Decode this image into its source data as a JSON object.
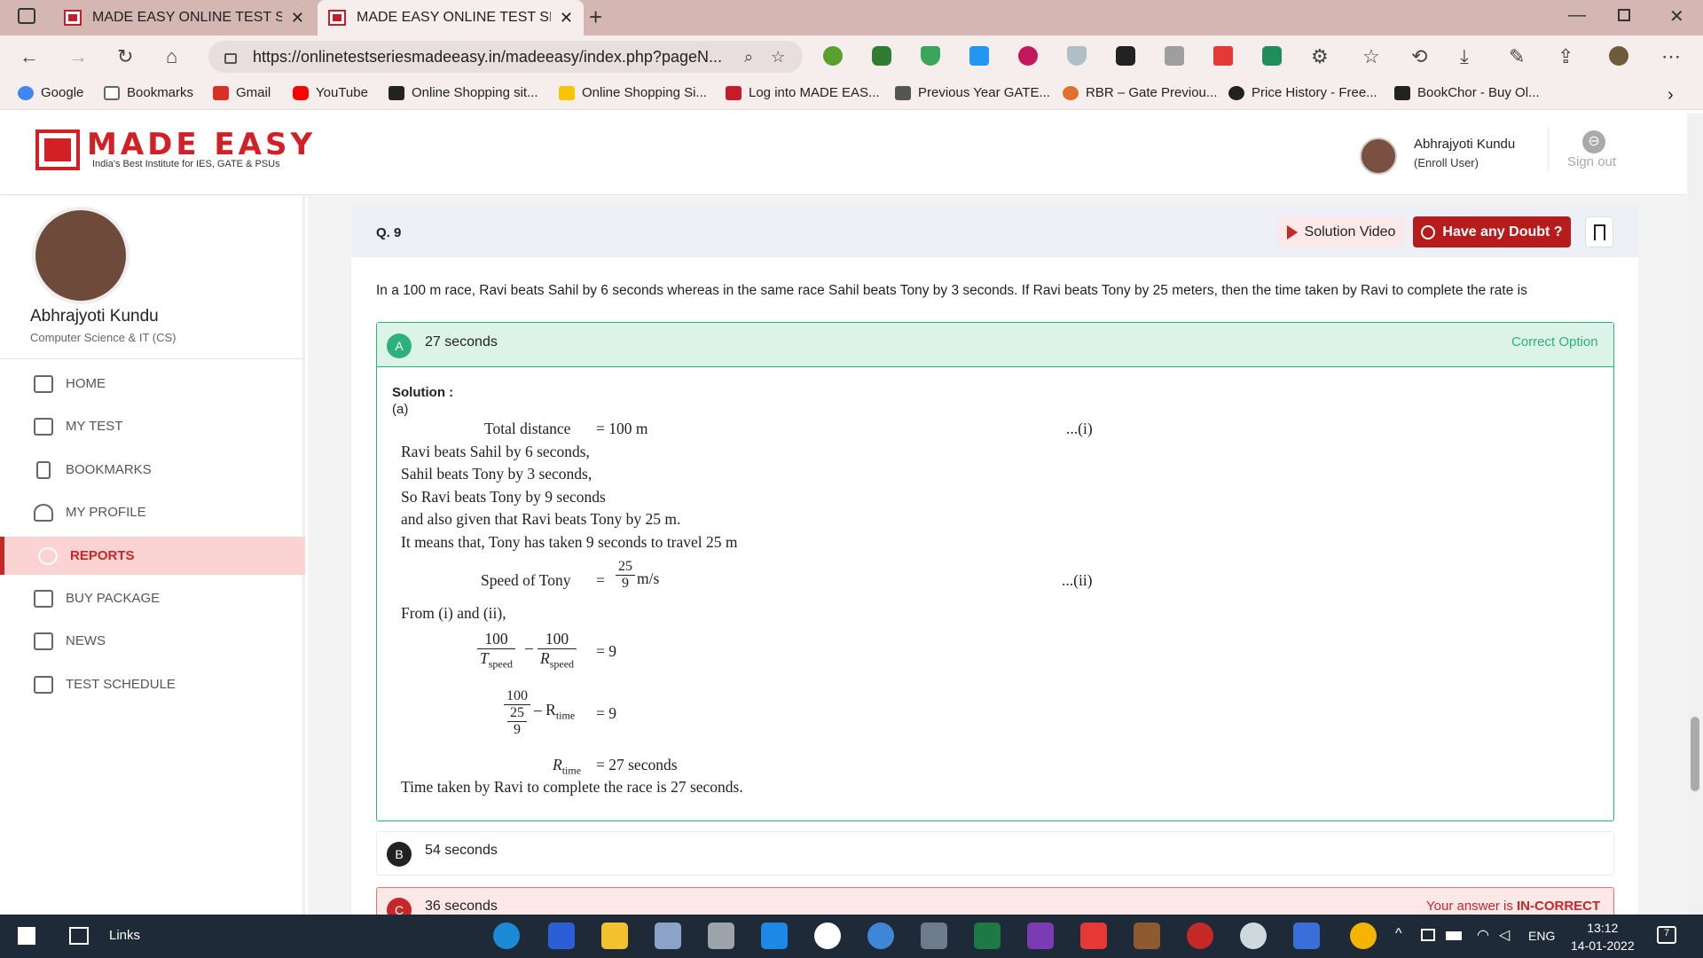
{
  "browser": {
    "tabs": [
      {
        "title": "MADE EASY ONLINE TEST SERIES"
      },
      {
        "title": "MADE EASY ONLINE TEST SERIES"
      }
    ],
    "new_tab": "+",
    "url": "https://onlinetestseriesmadeeasy.in/madeeasy/index.php?pageN...",
    "bookmarks": [
      {
        "label": "Google",
        "icon": "google-icon",
        "color": "#4285f4"
      },
      {
        "label": "Bookmarks",
        "icon": "page-icon",
        "color": "#666666"
      },
      {
        "label": "Gmail",
        "icon": "gmail-icon",
        "color": "#d93025"
      },
      {
        "label": "YouTube",
        "icon": "youtube-icon",
        "color": "#ff0000"
      },
      {
        "label": "Online Shopping sit...",
        "icon": "amazon-icon",
        "color": "#222222"
      },
      {
        "label": "Online Shopping Si...",
        "icon": "flipkart-icon",
        "color": "#f7c600"
      },
      {
        "label": "Log into MADE EAS...",
        "icon": "madeeasy-icon",
        "color": "#c41e2a"
      },
      {
        "label": "Previous Year GATE...",
        "icon": "gate-icon",
        "color": "#555555"
      },
      {
        "label": "RBR – Gate Previou...",
        "icon": "rbr-icon",
        "color": "#e0702a"
      },
      {
        "label": "Price History - Free...",
        "icon": "pricehistory-icon",
        "color": "#222222"
      },
      {
        "label": "BookChor - Buy Ol...",
        "icon": "bookchor-icon",
        "color": "#222222"
      }
    ]
  },
  "site": {
    "logo_name": "MADE EASY",
    "logo_tagline": "India's Best Institute for IES, GATE & PSUs",
    "user_name": "Abhrajyoti Kundu",
    "user_role": "(Enroll User)",
    "signout": "Sign out"
  },
  "sidebar": {
    "name": "Abhrajyoti Kundu",
    "branch": "Computer Science & IT (CS)",
    "menu": [
      {
        "label": "HOME",
        "icon": "home-icon"
      },
      {
        "label": "MY TEST",
        "icon": "test-icon"
      },
      {
        "label": "BOOKMARKS",
        "icon": "bookmark-icon"
      },
      {
        "label": "MY PROFILE",
        "icon": "user-icon"
      },
      {
        "label": "REPORTS",
        "icon": "reports-icon",
        "active": true
      },
      {
        "label": "BUY PACKAGE",
        "icon": "cart-icon"
      },
      {
        "label": "NEWS",
        "icon": "news-icon"
      },
      {
        "label": "TEST SCHEDULE",
        "icon": "schedule-icon"
      }
    ]
  },
  "question": {
    "number": "Q. 9",
    "solution_video": "Solution Video",
    "doubt": "Have any Doubt ?",
    "text": "In a 100 m race, Ravi beats Sahil by 6 seconds whereas in the same race Sahil beats Tony by 3 seconds. If Ravi beats Tony by 25 meters, then the time taken by Ravi to complete the rate is",
    "options": [
      {
        "letter": "A",
        "text": "27 seconds",
        "status": "Correct Option"
      },
      {
        "letter": "B",
        "text": "54 seconds",
        "status": ""
      },
      {
        "letter": "C",
        "text": "36 seconds",
        "status_prefix": "Your answer is ",
        "status": "IN-CORRECT"
      }
    ],
    "solution": {
      "label": "Solution :",
      "answer": "(a)",
      "l1_lhs": "Total distance",
      "l1_rhs": "=  100 m",
      "l1_tag": "...(i)",
      "l2": "Ravi beats Sahil by 6 seconds,",
      "l3": "Sahil beats Tony by 3 seconds,",
      "l4": "So Ravi beats Tony by 9 seconds",
      "l5": "and also given that Ravi beats Tony by 25 m.",
      "l6": "It means that, Tony has taken 9 seconds to travel 25 m",
      "speed_lhs": "Speed of Tony",
      "eq": "=",
      "speed_num": "25",
      "speed_den": "9",
      "speed_unit": "m/s",
      "speed_tag": "...(ii)",
      "from": "From (i) and (ii),",
      "f1_num": "100",
      "f1_den_main": "T",
      "f1_den_sub": "speed",
      "minus": "–",
      "f2_num": "100",
      "f2_den_main": "R",
      "f2_den_sub": "speed",
      "eq9": "=  9",
      "g_num": "100",
      "g_den_num": "25",
      "g_den_den": "9",
      "g_minus": "– R",
      "g_sub": "time",
      "eq9b": "=  9",
      "r_main": "R",
      "r_sub": "time",
      "r_rhs": "=  27 seconds",
      "final": "Time taken by Ravi to complete the race is 27 seconds."
    }
  },
  "taskbar": {
    "links": "Links",
    "lang": "ENG",
    "time": "13:12",
    "date": "14-01-2022",
    "notif": "7"
  },
  "colors": {
    "brand": "#d32027",
    "correct": "#2db17a",
    "incorrect": "#c62828",
    "active_menu_bg": "#fcd3d3"
  }
}
